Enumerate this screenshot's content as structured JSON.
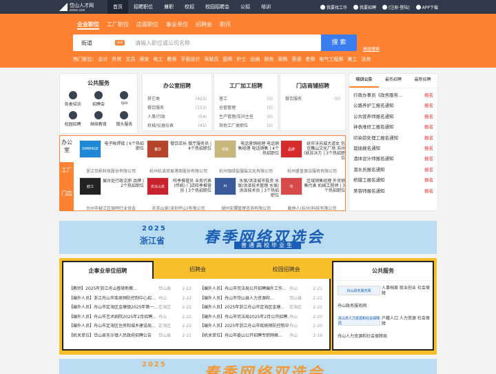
{
  "site": {
    "name": "岱山人才网",
    "domain": "zsdsrc.com"
  },
  "nav": [
    "首页",
    "招聘职位",
    "兼职",
    "校招",
    "校园招聘会",
    "公招",
    "培训"
  ],
  "right_nav": [
    {
      "label": "我要找工作",
      "icon": "person-icon"
    },
    {
      "label": "我要招聘",
      "icon": "briefcase-icon"
    },
    {
      "label": "[注册·登陆]",
      "icon": "user-icon"
    },
    {
      "label": "APP下载",
      "icon": "phone-icon"
    }
  ],
  "search": {
    "tabs": [
      "企业职位",
      "工厂职位",
      "店面职位",
      "事业单位",
      "招聘会",
      "职讯"
    ],
    "city": "街道",
    "change": "更改",
    "placeholder": "请输入职位或公司名称",
    "button": "搜 索",
    "advanced": "高级搜索"
  },
  "hot": {
    "label": "热门职位:",
    "items": [
      "会计",
      "外贸",
      "文员",
      "保安",
      "电工",
      "教师",
      "平面设计",
      "驾驶员",
      "厨师",
      "护士",
      "出纳",
      "财务",
      "采购",
      "英语",
      "老师",
      "电气工程师",
      "美工",
      "法务"
    ]
  },
  "public_service": {
    "title": "公共服务",
    "items": [
      "各类培训",
      "招聘会",
      "rpo",
      "校园招聘",
      "继续教育",
      "猎头服务"
    ]
  },
  "office": {
    "title": "办公室招聘",
    "rows": [
      [
        "其它类",
        "(423)"
      ],
      [
        "餐饮服务",
        "(153)"
      ],
      [
        "人事/行政",
        "(54)"
      ],
      [
        "机械/仪器仪表",
        "(45)"
      ]
    ]
  },
  "factory": {
    "title": "工厂加工招聘",
    "rows": [
      [
        "普工",
        "(0)"
      ],
      [
        "仓管管理",
        "(0)"
      ],
      [
        "生产管理/车间主任",
        "(0)"
      ],
      [
        "其他工厂类职位",
        "(0)"
      ]
    ]
  },
  "shop": {
    "title": "门店商铺招聘",
    "rows": [
      [
        "餐饮服务",
        "(0)"
      ]
    ]
  },
  "feature_tabs": [
    "办公室",
    "工厂",
    "门店"
  ],
  "companies": [
    {
      "logo": "SIMMAGE",
      "desc": "电子帐焊接 | 6个热招职位",
      "company": "浙江岱影科技股份有限公司",
      "color": "#1e88d6"
    },
    {
      "logo": "餐饮",
      "desc": "餐饮店长 餐厅服务员 | 4个热招职位",
      "company": "杭州杭诺贸易港商股份有限公司",
      "color": "#b5452a"
    },
    {
      "logo": "绿色",
      "desc": "电话营销经理 电话销售经理 电话销售 | 4个热招职位",
      "company": "杭州强绿盐服装文化有限公司",
      "color": "#c7b77a"
    },
    {
      "logo": "品牌",
      "desc": "妖芬沃苏城大道女 包佳舞山文化厂场 苏州(妖苏沃方 | 3个热招职位",
      "company": "杭州盛皇保洁服务有限公司",
      "color": "#d62b2b"
    },
    {
      "logo": "欧江",
      "desc": "展台处行政文职 品牌 | 2个热招职位",
      "company": "台州市椒江区银明行业协会",
      "color": "#222"
    },
    {
      "logo": "农夫山泉",
      "desc": "旺季推营员 业务代表 (传统) 门店旺季推营员 | 3个热招职位",
      "company": "农夫山泉(深圳坪山)有限公司",
      "color": "#c8222e"
    },
    {
      "logo": "AI",
      "desc": "水保/洪泽城市投资 水保/洪泽技术管理 水保/洪泽技术员 | 3个热招职位",
      "company": "湖州安瀾管理咨询有限公司",
      "color": "#3a5a9a"
    },
    {
      "logo": "花",
      "desc": "区域销售经理 外贸销售代表 机械工程师 | 3个热招职位",
      "company": "截林人(杭州)科技有限公司",
      "color": "#d64a4a"
    }
  ],
  "side": {
    "tabs": [
      "培训公告",
      "最热招聘",
      "最新招聘"
    ],
    "items": [
      {
        "t": "行政办事员《政务服务...",
        "s": "报名"
      },
      {
        "t": "公路养护工报名通知",
        "s": "报名"
      },
      {
        "t": "公共营养师报名通知",
        "s": "报名"
      },
      {
        "t": "钟表维修工报名通知",
        "s": "报名"
      },
      {
        "t": "印染前处理工报名通知",
        "s": "报名"
      },
      {
        "t": "栽插报名通知",
        "s": "报名"
      },
      {
        "t": "酒体设计师报名通知",
        "s": "报名"
      },
      {
        "t": "潜水员报名通知",
        "s": "报名"
      },
      {
        "t": "桥隧工报名通知",
        "s": "报名"
      },
      {
        "t": "美容师报名通知",
        "s": "报名"
      }
    ]
  },
  "banner": {
    "year": "2025",
    "province": "浙江省",
    "title": "春季网络双选会",
    "subtitle": "普通高校毕业生"
  },
  "postings": {
    "tabs": [
      "企事业单位招聘",
      "招聘会",
      "校园招聘会"
    ],
    "left": [
      [
        "【教师】2025年浙江舟山普陵新教...",
        "岱山县",
        "2-22"
      ],
      [
        "【编外人员】浙江舟山市疾病预防控制中心招...",
        "舟山",
        "2-22"
      ],
      [
        "【编外人员】舟山市定海区金塘镇2025年第一...",
        "定海区",
        "2-22"
      ],
      [
        "【编外人员】舟山市艺术剧院2025年2月招聘...",
        "舟山",
        "2-22"
      ],
      [
        "【编外人员】舟山市定海区住房和城乡建设局...",
        "定海区",
        "2-22"
      ],
      [
        "【机关单位】岱山县东沙镇人民政府招聘公告",
        "岱山县",
        "2-21"
      ]
    ],
    "right": [
      [
        "【编外人员】舟山市司法局公开招聘编外工作...",
        "舟山",
        "2-21"
      ],
      [
        "【编外人员】舟山市岱山县人力资源和...",
        "岱山县",
        "2-21"
      ],
      [
        "【编外人员】2025年浙江舟山市定海区金塘...",
        "定海区",
        "2-21"
      ],
      [
        "【编外人员】舟山市司法局2025年2月公开招聘...",
        "舟山",
        "2-20"
      ],
      [
        "【编外人员】2025年浙江舟山市疾病预防控制中...",
        "舟山",
        "2-20"
      ],
      [
        "【机关单位】舟山市委山公开招聘专职网格...",
        "舟山",
        "2-19"
      ]
    ]
  },
  "pubserv": {
    "title": "公共服务",
    "items": [
      {
        "box": "舟山政务服务网",
        "text": "人事档案 就业创业 社会保障",
        "name": "舟山政务服务网"
      },
      {
        "box": "舟山市人力资源和社会保障局",
        "text": "户籍人口 人力资源 社会保障",
        "name": "舟山人力资源和社会保障局"
      }
    ]
  },
  "colors": {
    "orange": "#ff8233",
    "dark": "#303a4a",
    "blue": "#3c7df0",
    "yellow": "#f8bf2a"
  }
}
